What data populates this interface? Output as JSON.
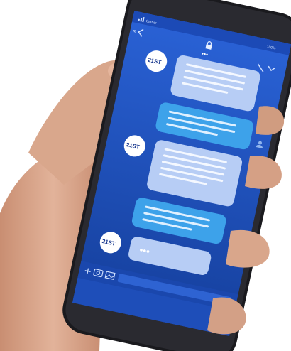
{
  "status_bar": {
    "carrier": "Carrier",
    "battery": "100%"
  },
  "top_bar": {
    "back": "3",
    "indicator": "•••"
  },
  "chat": {
    "avatar_text": "21ST",
    "typing_indicator": "•••",
    "messages": [
      {
        "from": "bot",
        "lines": 4
      },
      {
        "from": "user",
        "lines": 3
      },
      {
        "from": "bot",
        "lines": 5
      },
      {
        "from": "user",
        "lines": 3
      },
      {
        "from": "bot",
        "lines": 0,
        "typing": true
      }
    ]
  },
  "colors": {
    "screen": "#1f52c6",
    "screen_dark": "#143a9a",
    "bot_bubble": "#b7cdf5",
    "user_bubble": "#3da2ea",
    "skin": "#d7a58a",
    "phone_body": "#1a1a1e"
  },
  "icons": {
    "lock": "lock-icon",
    "signal": "signal-icon",
    "back": "chevron-left-icon",
    "edit": "pencil-icon",
    "collapse": "chevron-down-icon",
    "add": "plus-icon",
    "camera": "camera-icon",
    "gallery": "image-icon",
    "user": "user-icon",
    "send": "send-icon"
  }
}
